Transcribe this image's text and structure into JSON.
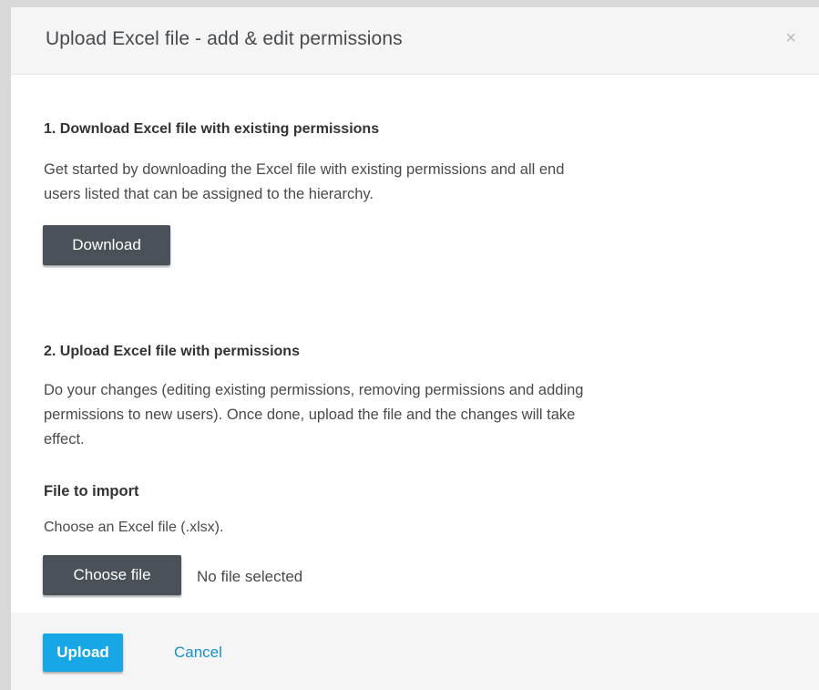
{
  "dialog": {
    "title": "Upload Excel file - add & edit permissions",
    "close_icon": "×"
  },
  "step1": {
    "title": "1. Download Excel file with existing permissions",
    "description_line1": "Get started by downloading the Excel file with existing permissions and all end",
    "description_line2": "users listed that can be assigned to the hierarchy.",
    "download_label": "Download"
  },
  "step2": {
    "title": "2. Upload Excel file with permissions",
    "description_line1": "Do your changes (editing existing permissions, removing permissions and adding",
    "description_line2": "permissions to new users). Once done, upload the file and the changes will take",
    "description_line3": "effect.",
    "file_label": "File to import",
    "file_hint": "Choose an Excel file (.xlsx).",
    "choose_file_label": "Choose file",
    "no_file_text": "No file selected"
  },
  "footer": {
    "upload_label": "Upload",
    "cancel_label": "Cancel"
  },
  "colors": {
    "primary": "#18a7e6",
    "dark_button": "#4a5159",
    "link": "#1a8fd0"
  }
}
